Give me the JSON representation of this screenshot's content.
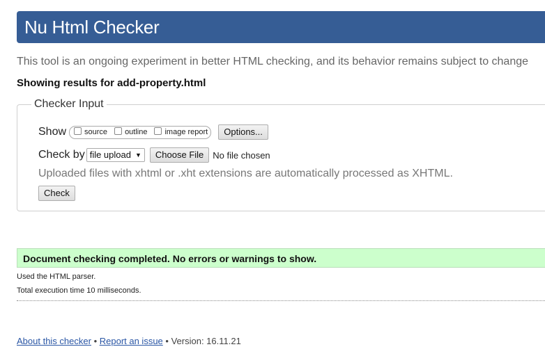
{
  "header": {
    "title": "Nu Html Checker"
  },
  "tagline": "This tool is an ongoing experiment in better HTML checking, and its behavior remains subject to change",
  "results_for": "Showing results for add-property.html",
  "checker_input": {
    "legend": "Checker Input",
    "show_label": "Show",
    "show_options": [
      {
        "label": "source",
        "checked": false
      },
      {
        "label": "outline",
        "checked": false
      },
      {
        "label": "image report",
        "checked": false
      }
    ],
    "options_button": "Options...",
    "check_by_label": "Check by",
    "check_by_value": "file upload",
    "choose_file_button": "Choose File",
    "no_file_text": "No file chosen",
    "note": "Uploaded files with xhtml or .xht extensions are automatically processed as XHTML.",
    "check_button": "Check"
  },
  "result": {
    "message": "Document checking completed. No errors or warnings to show.",
    "color": "#ccffcc"
  },
  "details": {
    "parser": "Used the HTML parser.",
    "execution": "Total execution time 10 milliseconds."
  },
  "footer": {
    "about_link": "About this checker",
    "report_link": "Report an issue",
    "separator": " • ",
    "version_label": "Version: 16.11.21"
  },
  "colors": {
    "header_bg": "#365d95",
    "link": "#2a56a5"
  }
}
